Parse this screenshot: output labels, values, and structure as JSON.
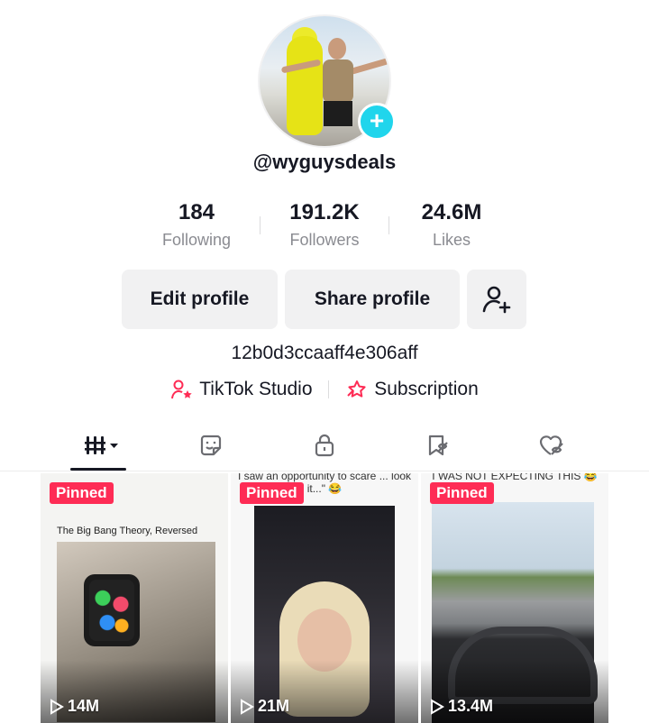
{
  "profile": {
    "username": "@wyguysdeals",
    "bio": "12b0d3ccaaff4e306aff"
  },
  "stats": [
    {
      "value": "184",
      "label": "Following"
    },
    {
      "value": "191.2K",
      "label": "Followers"
    },
    {
      "value": "24.6M",
      "label": "Likes"
    }
  ],
  "buttons": {
    "edit": "Edit profile",
    "share": "Share profile",
    "add_friend_icon": "add-friend-icon"
  },
  "links": {
    "studio": "TikTok Studio",
    "subscription": "Subscription"
  },
  "tabs": [
    {
      "icon": "videos-grid-icon",
      "active": true
    },
    {
      "icon": "reposts-icon",
      "active": false
    },
    {
      "icon": "private-lock-icon",
      "active": false
    },
    {
      "icon": "favorites-icon",
      "active": false
    },
    {
      "icon": "liked-icon",
      "active": false
    }
  ],
  "videos": [
    {
      "pinned": "Pinned",
      "caption": "The Big Bang Theory, Reversed",
      "top_caption": "",
      "views": "14M"
    },
    {
      "pinned": "Pinned",
      "caption": "",
      "top_caption": "I saw an opportunity to scare ... look it...\" 😂",
      "views": "21M"
    },
    {
      "pinned": "Pinned",
      "caption": "",
      "top_caption": "I WAS NOT EXPECTING THIS 😂",
      "views": "13.4M"
    }
  ],
  "colors": {
    "accent": "#fe2c55",
    "plus_badge": "#20d5ec",
    "text": "#161823",
    "muted": "#8a8b91"
  }
}
